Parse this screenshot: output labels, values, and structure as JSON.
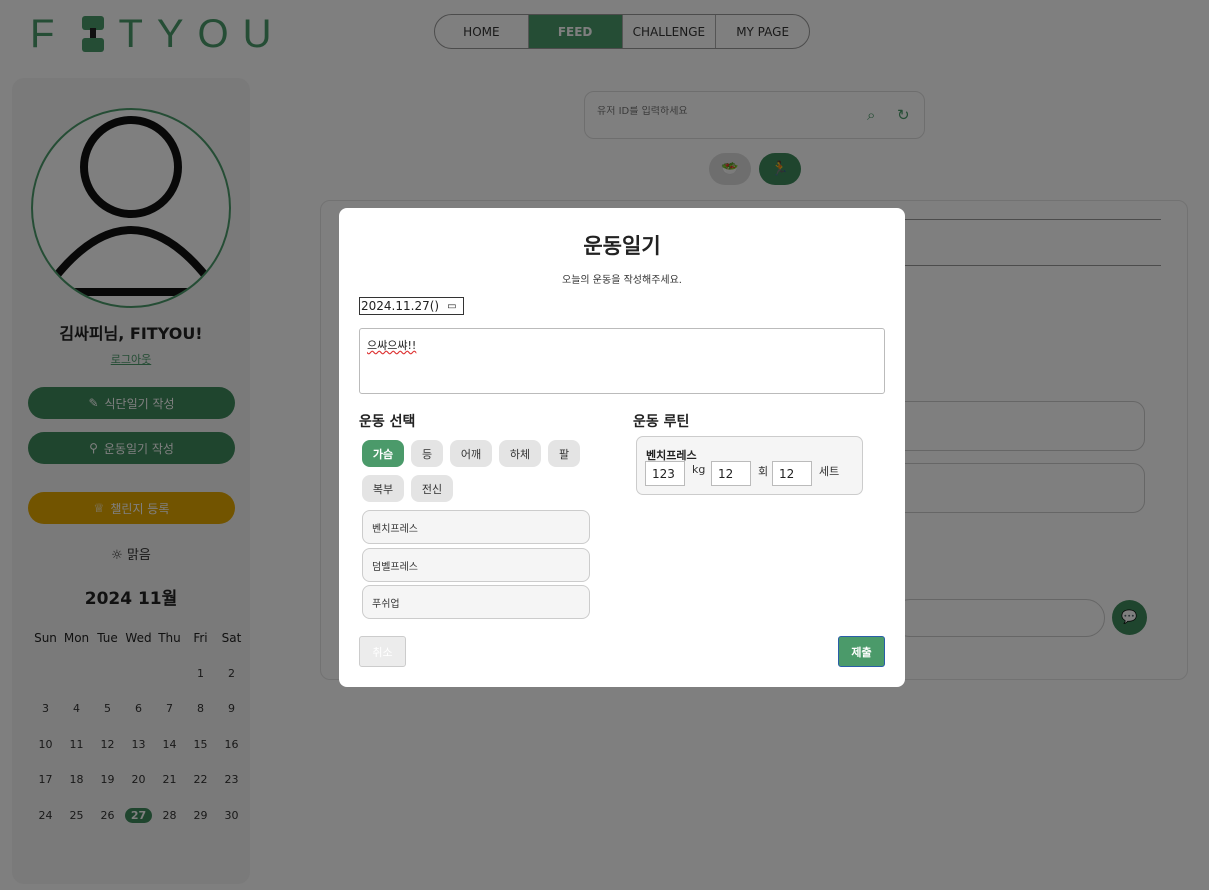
{
  "header": {
    "logo_text": "FITYOU",
    "nav": [
      {
        "label": "HOME",
        "active": false
      },
      {
        "label": "FEED",
        "active": true
      },
      {
        "label": "CHALLENGE",
        "active": false
      },
      {
        "label": "MY PAGE",
        "active": false
      }
    ]
  },
  "sidebar": {
    "greeting": "김싸피님, FITYOU!",
    "logout": "로그아웃",
    "diet_button": "식단일기 작성",
    "workout_button": "운동일기 작성",
    "challenge_button": "챌린지 등록",
    "weather": "맑음",
    "calendar": {
      "title": "2024 11월",
      "weekdays": [
        "Sun",
        "Mon",
        "Tue",
        "Wed",
        "Thu",
        "Fri",
        "Sat"
      ],
      "weeks": [
        [
          "",
          "",
          "",
          "",
          "",
          "1",
          "2"
        ],
        [
          "3",
          "4",
          "5",
          "6",
          "7",
          "8",
          "9"
        ],
        [
          "10",
          "11",
          "12",
          "13",
          "14",
          "15",
          "16"
        ],
        [
          "17",
          "18",
          "19",
          "20",
          "21",
          "22",
          "23"
        ],
        [
          "24",
          "25",
          "26",
          "27",
          "28",
          "29",
          "30"
        ]
      ],
      "today": "27"
    }
  },
  "search": {
    "placeholder": "유저 ID를 입력하세요"
  },
  "modal": {
    "title": "운동일기",
    "subtitle": "오늘의 운동을 작성해주세요.",
    "date_value": "2024.11.27()",
    "memo_value": "으쌰으쌰!!",
    "exercise_select_title": "운동 선택",
    "routine_title": "운동 루틴",
    "categories": [
      {
        "label": "가슴",
        "active": true
      },
      {
        "label": "등",
        "active": false
      },
      {
        "label": "어깨",
        "active": false
      },
      {
        "label": "하체",
        "active": false
      },
      {
        "label": "팔",
        "active": false
      },
      {
        "label": "복부",
        "active": false
      },
      {
        "label": "전신",
        "active": false
      }
    ],
    "exercises": [
      "벤치프레스",
      "덤벨프레스",
      "푸쉬업"
    ],
    "routine": {
      "name": "벤치프레스",
      "weight": "123",
      "weight_unit": "kg",
      "reps": "12",
      "reps_unit": "회",
      "sets": "12",
      "sets_unit": "세트"
    },
    "cancel_label": "취소",
    "submit_label": "제출"
  },
  "colors": {
    "brand_green": "#4b9a6a",
    "challenge_yellow": "#e5a800"
  }
}
